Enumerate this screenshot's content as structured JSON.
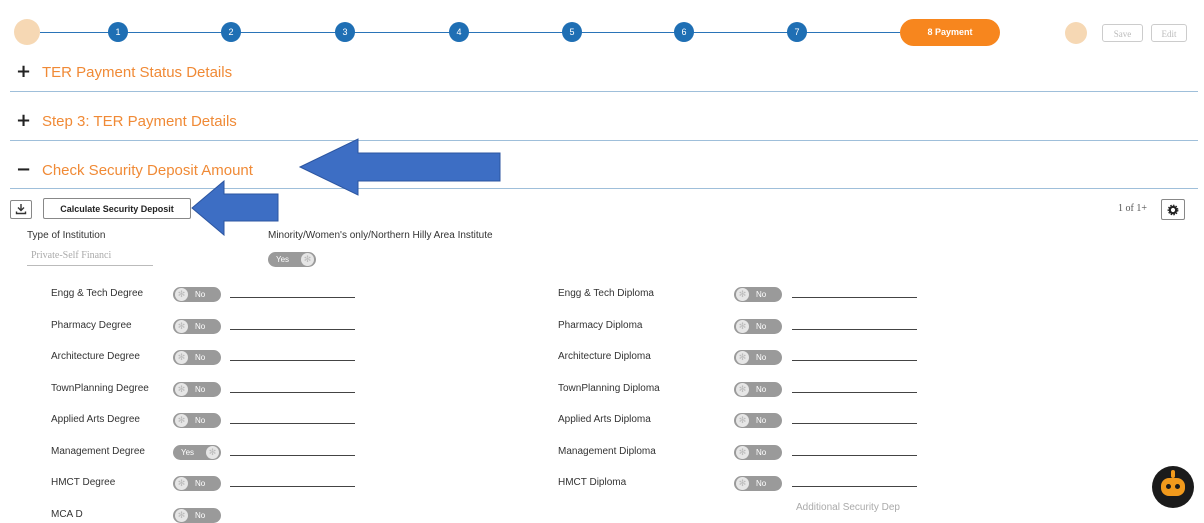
{
  "stepper": {
    "steps": [
      "1",
      "2",
      "3",
      "4",
      "5",
      "6",
      "7"
    ],
    "active_label": "8  Payment",
    "save_label": "Save",
    "edit_label": "Edit"
  },
  "sections": {
    "ter_status": "TER Payment Status Details",
    "ter_details": "Step 3: TER Payment Details",
    "security": "Check Security Deposit Amount",
    "plus_sign": "+",
    "minus_sign": "−"
  },
  "toolbar": {
    "calc_label": "Calculate Security Deposit",
    "pager": "1 of 1+"
  },
  "form": {
    "type_label": "Type of Institution",
    "type_value": "Private-Self Financi",
    "minority_label": "Minority/Women's only/Northern Hilly Area Institute",
    "minority_toggle": "Yes",
    "additional_label": "Additional Security Dep",
    "left_rows": [
      {
        "label": "Engg & Tech Degree",
        "toggle": "No"
      },
      {
        "label": "Pharmacy Degree",
        "toggle": "No"
      },
      {
        "label": "Architecture Degree",
        "toggle": "No"
      },
      {
        "label": "TownPlanning Degree",
        "toggle": "No"
      },
      {
        "label": "Applied Arts Degree",
        "toggle": "No"
      },
      {
        "label": "Management Degree",
        "toggle": "Yes"
      },
      {
        "label": "HMCT Degree",
        "toggle": "No"
      },
      {
        "label": "MCA D",
        "toggle": "No"
      }
    ],
    "right_rows": [
      {
        "label": "Engg & Tech Diploma",
        "toggle": "No"
      },
      {
        "label": "Pharmacy Diploma",
        "toggle": "No"
      },
      {
        "label": "Architecture Diploma",
        "toggle": "No"
      },
      {
        "label": "TownPlanning Diploma",
        "toggle": "No"
      },
      {
        "label": "Applied Arts Diploma",
        "toggle": "No"
      },
      {
        "label": "Management Diploma",
        "toggle": "No"
      },
      {
        "label": "HMCT Diploma",
        "toggle": "No"
      }
    ]
  },
  "colors": {
    "accent_orange": "#f7861e",
    "step_blue": "#1f6fb4",
    "annotation_arrow": "#3d6ec4"
  }
}
